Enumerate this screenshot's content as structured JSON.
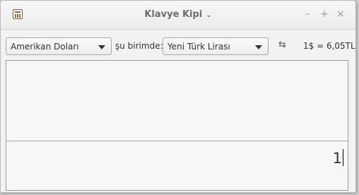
{
  "window": {
    "title": "Klavye Kipi",
    "title_chevron_icon": "chevron-down-icon",
    "app_icon": "calculator-icon",
    "minimize_glyph": "–",
    "maximize_glyph": "+",
    "close_glyph": "×"
  },
  "toolbar": {
    "from_currency": "Amerikan Doları",
    "unit_label": "şu birimde:",
    "to_currency": "Yeni Türk Lirası",
    "swap_icon": "swap-icon",
    "swap_glyph": "⇆",
    "rate_text": "1$ = 6,05TL"
  },
  "display": {
    "input_value": "1"
  }
}
